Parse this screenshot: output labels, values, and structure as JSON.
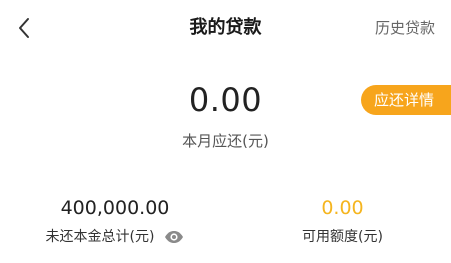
{
  "header": {
    "back_icon": "chevron-left-icon",
    "title": "我的贷款",
    "history_link": "历史贷款"
  },
  "summary": {
    "due_amount": "0.00",
    "due_label": "本月应还(元)",
    "detail_button": "应还详情"
  },
  "stats": {
    "outstanding_principal": {
      "value": "400,000.00",
      "label": "未还本金总计(元)",
      "visibility_icon": "eye-icon"
    },
    "available_credit": {
      "value": "0.00",
      "label": "可用额度(元)"
    }
  },
  "colors": {
    "accent": "#f7a51c",
    "accent_text": "#f5b51f"
  }
}
